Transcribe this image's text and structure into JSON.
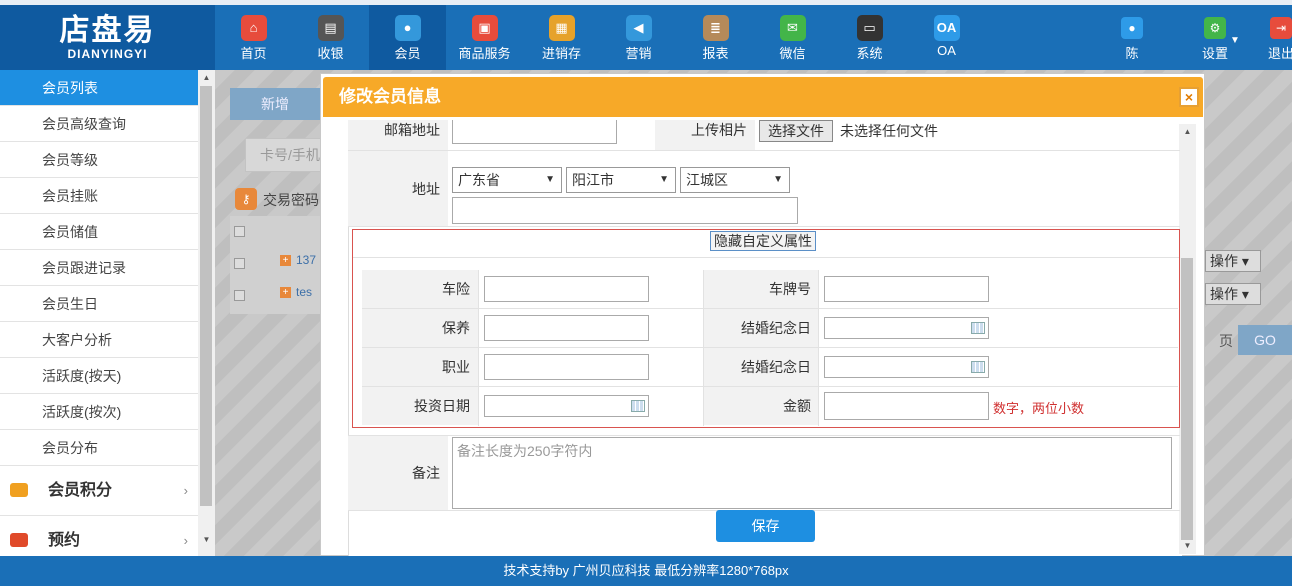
{
  "logo": {
    "cn": "店盘易",
    "en": "DIANYINGYI"
  },
  "nav": [
    {
      "label": "首页",
      "icon": "home-icon",
      "color": "#e74c3c",
      "glyph": "⌂"
    },
    {
      "label": "收银",
      "icon": "cash-register-icon",
      "color": "#555555",
      "glyph": "▤"
    },
    {
      "label": "会员",
      "icon": "member-icon",
      "color": "#3498db",
      "glyph": "●"
    },
    {
      "label": "商品服务",
      "icon": "goods-icon",
      "color": "#e74c3c",
      "glyph": "▣"
    },
    {
      "label": "进销存",
      "icon": "inventory-icon",
      "color": "#e6a22b",
      "glyph": "▦"
    },
    {
      "label": "营销",
      "icon": "megaphone-icon",
      "color": "#3498db",
      "glyph": "◀"
    },
    {
      "label": "报表",
      "icon": "report-icon",
      "color": "#b58a5a",
      "glyph": "≣"
    },
    {
      "label": "微信",
      "icon": "wechat-icon",
      "color": "#43b549",
      "glyph": "✉"
    },
    {
      "label": "系统",
      "icon": "monitor-icon",
      "color": "#333333",
      "glyph": "▭"
    },
    {
      "label": "OA",
      "icon": "oa-icon",
      "color": "#2e9be8",
      "glyph": "OA"
    }
  ],
  "right_nav": {
    "user": {
      "label": "陈",
      "icon": "user-icon"
    },
    "settings": {
      "label": "设置",
      "icon": "gear-icon"
    },
    "logout": {
      "label": "退出",
      "icon": "logout-icon"
    }
  },
  "sidebar": {
    "items": [
      "会员列表",
      "会员高级查询",
      "会员等级",
      "会员挂账",
      "会员储值",
      "会员跟进记录",
      "会员生日",
      "大客户分析",
      "活跃度(按天)",
      "活跃度(按次)",
      "会员分布"
    ],
    "active_index": 0,
    "groups": [
      {
        "label": "会员积分",
        "icon": "tag-icon",
        "color": "#f0a020"
      },
      {
        "label": "预约",
        "icon": "phone-icon",
        "color": "#e04a2a"
      }
    ]
  },
  "background": {
    "new_button": "新增",
    "search_placeholder": "卡号/手机",
    "trade_password": "交易密码",
    "row1": "137",
    "row2": "tes",
    "op_label": "操作 ▾",
    "page_label": "页",
    "go_button": "GO"
  },
  "modal": {
    "title": "修改会员信息",
    "close": "×",
    "email_label": "邮箱地址",
    "upload_label": "上传相片",
    "file_button": "选择文件",
    "file_none": "未选择任何文件",
    "address_label": "地址",
    "province": "广东省",
    "city": "阳江市",
    "district": "江城区",
    "toggle_custom": "隐藏自定义属性",
    "custom_fields": {
      "car_insurance": "车险",
      "plate_number": "车牌号",
      "maintenance": "保养",
      "wedding_anniv_1": "结婚纪念日",
      "occupation": "职业",
      "wedding_anniv_2": "结婚纪念日",
      "invest_date": "投资日期",
      "amount": "金额",
      "amount_hint": "数字，两位小数"
    },
    "remark_label": "备注",
    "remark_placeholder": "备注长度为250字符内",
    "save_button": "保存"
  },
  "footer": "技术支持by 广州贝应科技     最低分辨率1280*768px"
}
